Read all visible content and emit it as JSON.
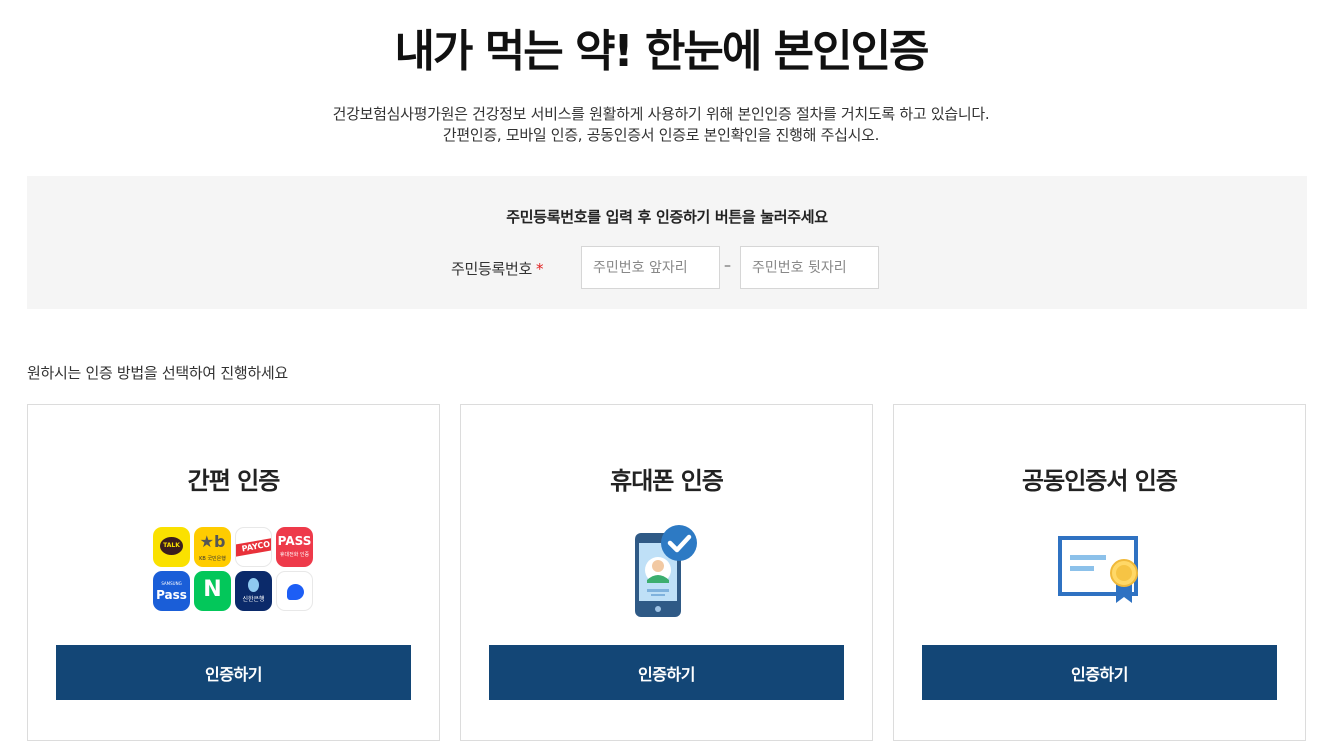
{
  "page": {
    "title": "내가 먹는 약! 한눈에 본인인증",
    "description_line1": "건강보험심사평가원은 건강정보 서비스를 원활하게 사용하기 위해 본인인증 절차를 거치도록 하고 있습니다.",
    "description_line2": "간편인증, 모바일 인증, 공동인증서 인증로 본인확인을 진행해 주십시오."
  },
  "rrn_form": {
    "guide": "주민등록번호를 입력 후 인증하기 버튼을 눌러주세요",
    "label": "주민등록번호",
    "required_mark": "*",
    "front_placeholder": "주민번호 앞자리",
    "front_value": "",
    "separator": "–",
    "back_placeholder": "주민번호 뒷자리",
    "back_value": ""
  },
  "method_guide": "원하시는 인증 방법을 선택하여 진행하세요",
  "methods": [
    {
      "title": "간편 인증",
      "button": "인증하기",
      "apps": [
        {
          "icon": "kakaotalk-icon",
          "label": "TALK"
        },
        {
          "icon": "kb-bank-icon",
          "label": "KB 국민은행"
        },
        {
          "icon": "payco-icon",
          "label": "PAYCO"
        },
        {
          "icon": "pass-icon",
          "label": "PASS",
          "sublabel": "휴대전화 인증"
        },
        {
          "icon": "samsung-pass-icon",
          "label": "Pass",
          "sublabel": "SAMSUNG"
        },
        {
          "icon": "naver-icon",
          "label": "N"
        },
        {
          "icon": "shinhan-bank-icon",
          "label": "신한은행"
        },
        {
          "icon": "toss-icon",
          "label": ""
        }
      ]
    },
    {
      "title": "휴대폰 인증",
      "button": "인증하기",
      "icon": "smartphone-check-icon"
    },
    {
      "title": "공동인증서 인증",
      "button": "인증하기",
      "icon": "certificate-icon"
    }
  ],
  "colors": {
    "primary_button": "#134676",
    "panel_bg": "#f5f5f5",
    "required": "#e02020"
  }
}
